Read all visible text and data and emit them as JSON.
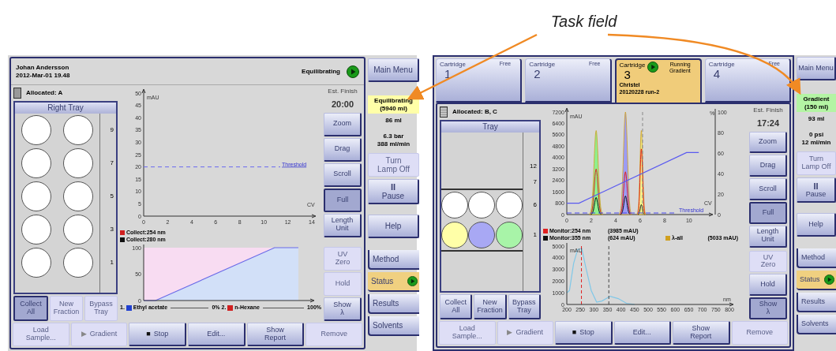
{
  "annotation": {
    "label": "Task field"
  },
  "screens": [
    {
      "header": {
        "user": "Johan Andersson",
        "date": "2012-Mar-01 19.48",
        "status": "Equilibrating"
      },
      "allocated": "Allocated: A",
      "tray": {
        "title": "Right Tray",
        "rows": [
          {
            "kind": "wells",
            "label": "9",
            "wells": [
              {
                "color": "#ffffff"
              },
              {
                "color": "#ffffff"
              }
            ]
          },
          {
            "kind": "wells",
            "label": "7",
            "wells": [
              {
                "color": "#ffffff"
              },
              {
                "color": "#ffffff"
              }
            ]
          },
          {
            "kind": "wells",
            "label": "5",
            "wells": [
              {
                "color": "#ffffff"
              },
              {
                "color": "#ffffff"
              }
            ]
          },
          {
            "kind": "wells",
            "label": "3",
            "wells": [
              {
                "color": "#ffffff"
              },
              {
                "color": "#ffffff"
              }
            ]
          },
          {
            "kind": "wells",
            "label": "1",
            "wells": [
              {
                "color": "#ffffff"
              },
              {
                "color": "#ffffff"
              }
            ]
          }
        ]
      },
      "tray_buttons": [
        {
          "label": "Collect\nAll",
          "pressed": true,
          "disabled": false
        },
        {
          "label": "New\nFraction",
          "pressed": false,
          "disabled": true
        },
        {
          "label": "Bypass\nTray",
          "pressed": false,
          "disabled": true
        }
      ],
      "main_chart": {
        "kind": "threshold",
        "y_unit": "mAU",
        "y_ticks": [
          "50",
          "45",
          "40",
          "35",
          "30",
          "25",
          "20",
          "15",
          "10",
          "5",
          "0"
        ],
        "x_unit": "CV",
        "x_ticks": [
          "0",
          "2",
          "4",
          "6",
          "8",
          "10",
          "12",
          "14"
        ],
        "threshold_label": "Threshold"
      },
      "legend": [
        {
          "color": "#d02020",
          "text": "Collect:254 nm"
        },
        {
          "color": "#111111",
          "text": "Collect:280 nm"
        }
      ],
      "lower_chart": {
        "kind": "gradient",
        "y_ticks": [
          "100",
          "50",
          "0"
        ]
      },
      "solvents": [
        {
          "number": "1.",
          "color": "#2040d0",
          "name": "Ethyl acetate",
          "value": "0%"
        },
        {
          "number": "2.",
          "color": "#d02020",
          "name": "n-Hexane",
          "value": "100%"
        }
      ],
      "est_finish": {
        "label": "Est. Finish",
        "time": "20:00"
      },
      "side_buttons": [
        {
          "label": "Zoom",
          "pressed": false,
          "disabled": false
        },
        {
          "label": "Drag",
          "pressed": false,
          "disabled": false
        },
        {
          "label": "Scroll",
          "pressed": false,
          "disabled": false
        },
        {
          "label": "Full",
          "pressed": true,
          "disabled": false
        },
        {
          "label": "Length\nUnit",
          "pressed": false,
          "disabled": false
        }
      ],
      "side_buttons_lower": [
        {
          "label": "UV\nZero",
          "pressed": false,
          "disabled": true
        },
        {
          "label": "Hold",
          "pressed": false,
          "disabled": true
        },
        {
          "label": "Show\nλ",
          "pressed": false,
          "disabled": false
        }
      ],
      "bottom_buttons": [
        {
          "label": "Load\nSample...",
          "disabled": true
        },
        {
          "symbol": "▶",
          "label": "Gradient",
          "disabled": true
        },
        {
          "symbol": "■",
          "label": "Stop",
          "disabled": false
        },
        {
          "label": "Edit...",
          "disabled": false
        },
        {
          "label": "Show\nReport",
          "disabled": false
        },
        {
          "label": "Remove",
          "disabled": true
        }
      ],
      "menu": {
        "main": "Main Menu",
        "task": {
          "text": "Equilibrating\n(5940 ml)",
          "color": "#ffffa8"
        },
        "volume": "86 ml",
        "readings": "6.3 bar\n388 ml/min",
        "lamp": {
          "label": "Turn\nLamp Off",
          "disabled": true
        },
        "pause": {
          "symbol": "II",
          "label": "Pause"
        },
        "tabs": [
          {
            "label": "Help",
            "kind": "button",
            "selected": false
          },
          {
            "label": "Method",
            "kind": "tab",
            "selected": false
          },
          {
            "label": "Status",
            "kind": "tab",
            "selected": true
          },
          {
            "label": "Results",
            "kind": "tab",
            "selected": false
          },
          {
            "label": "Solvents",
            "kind": "tab",
            "selected": false
          }
        ]
      }
    },
    {
      "cartridges": [
        {
          "label": "Cartridge",
          "number": "1",
          "status": "Free",
          "selected": false
        },
        {
          "label": "Cartridge",
          "number": "2",
          "status": "Free",
          "selected": false
        },
        {
          "label": "Cartridge",
          "number": "3",
          "status": "Running\nGradient",
          "user": "Christel",
          "run": "20120228 run-2",
          "selected": true
        },
        {
          "label": "Cartridge",
          "number": "4",
          "status": "Free",
          "selected": false
        }
      ],
      "allocated": "Allocated: B, C",
      "tray": {
        "title": "Tray",
        "rows": [
          {
            "kind": "empty",
            "label": "12"
          },
          {
            "kind": "empty",
            "label": "7"
          },
          {
            "kind": "wells",
            "label": "6",
            "wells": [
              {
                "color": "#ffffff"
              },
              {
                "color": "#ffffff"
              },
              {
                "color": "#ffffff"
              }
            ]
          },
          {
            "kind": "wells",
            "label": "1",
            "wells": [
              {
                "color": "#ffffa8"
              },
              {
                "color": "#a8a8f4"
              },
              {
                "color": "#a8f4a8"
              }
            ]
          },
          {
            "kind": "empty"
          }
        ]
      },
      "tray_buttons": [
        {
          "label": "Collect\nAll",
          "pressed": false,
          "disabled": false
        },
        {
          "label": "New\nFraction",
          "pressed": false,
          "disabled": false
        },
        {
          "label": "Bypass\nTray",
          "pressed": false,
          "disabled": false
        }
      ],
      "main_chart": {
        "kind": "peaks",
        "y_unit": "mAU",
        "y_ticks": [
          "7200",
          "6400",
          "5600",
          "4800",
          "4000",
          "3200",
          "2400",
          "1600",
          "800",
          "0"
        ],
        "x_unit": "CV",
        "x_ticks": [
          "0",
          "2",
          "4",
          "6",
          "8",
          "10"
        ],
        "threshold_label": "Threshold",
        "right_unit": "%",
        "right_ticks": [
          "100",
          "80",
          "60",
          "40",
          "20",
          "0"
        ]
      },
      "legend": [
        {
          "color": "#e02020",
          "text": "Monitor:254 nm",
          "reading": "(3985 mAU)"
        },
        {
          "color": "#111111",
          "text": "Monitor:355 nm",
          "reading": "(624 mAU)"
        },
        {
          "color": "#d0a020",
          "text": "λ-all",
          "reading": "(5033 mAU)"
        }
      ],
      "lower_chart": {
        "kind": "spectrum",
        "y_unit": "mAU",
        "y_ticks": [
          "5000",
          "4000",
          "3000",
          "2000",
          "1000",
          "0"
        ],
        "x_unit": "nm",
        "x_ticks": [
          "200",
          "250",
          "300",
          "350",
          "400",
          "450",
          "500",
          "550",
          "600",
          "650",
          "700",
          "750",
          "800"
        ]
      },
      "est_finish": {
        "label": "Est. Finish",
        "time": "17:24"
      },
      "side_buttons": [
        {
          "label": "Zoom",
          "pressed": false,
          "disabled": false
        },
        {
          "label": "Drag",
          "pressed": false,
          "disabled": false
        },
        {
          "label": "Scroll",
          "pressed": false,
          "disabled": false
        },
        {
          "label": "Full",
          "pressed": true,
          "disabled": false
        },
        {
          "label": "Length\nUnit",
          "pressed": false,
          "disabled": false
        }
      ],
      "side_buttons_lower": [
        {
          "label": "UV\nZero",
          "pressed": false,
          "disabled": true
        },
        {
          "label": "Hold",
          "pressed": false,
          "disabled": false
        },
        {
          "label": "Show\nλ",
          "pressed": true,
          "disabled": false
        }
      ],
      "bottom_buttons": [
        {
          "label": "Load\nSample...",
          "disabled": true
        },
        {
          "symbol": "▶",
          "label": "Gradient",
          "disabled": true
        },
        {
          "symbol": "■",
          "label": "Stop",
          "disabled": false
        },
        {
          "label": "Edit...",
          "disabled": false
        },
        {
          "label": "Show\nReport",
          "disabled": false
        },
        {
          "label": "Remove",
          "disabled": true
        }
      ],
      "menu": {
        "main": "Main Menu",
        "task": {
          "text": "Gradient\n(150 ml)",
          "color": "#b4f4a4"
        },
        "volume": "93 ml",
        "readings": "0 psi\n12 ml/min",
        "lamp": {
          "label": "Turn\nLamp Off",
          "disabled": true
        },
        "pause": {
          "symbol": "II",
          "label": "Pause"
        },
        "tabs": [
          {
            "label": "Help",
            "kind": "button",
            "selected": false
          },
          {
            "label": "Method",
            "kind": "tab",
            "selected": false
          },
          {
            "label": "Status",
            "kind": "tab",
            "selected": true
          },
          {
            "label": "Results",
            "kind": "tab",
            "selected": false
          },
          {
            "label": "Solvents",
            "kind": "tab",
            "selected": false
          }
        ]
      }
    }
  ]
}
